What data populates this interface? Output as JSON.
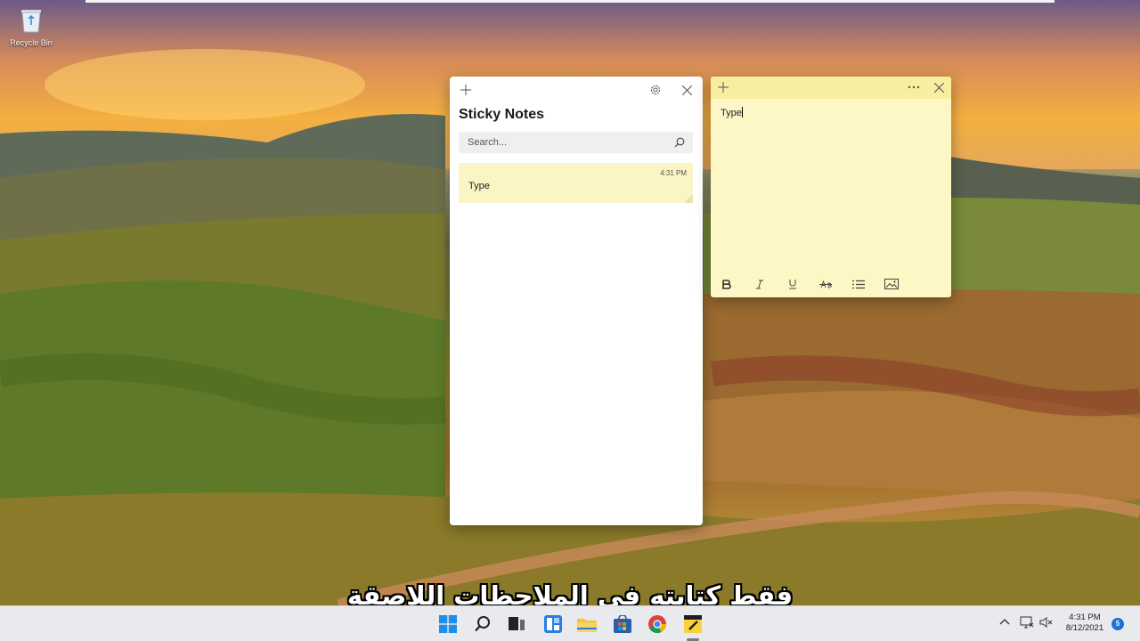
{
  "desktop": {
    "recycle_bin_label": "Recycle Bin"
  },
  "sticky_list": {
    "title": "Sticky Notes",
    "search_placeholder": "Search...",
    "notes": [
      {
        "time": "4:31 PM",
        "text": "Type"
      }
    ]
  },
  "sticky_note": {
    "text": "Type",
    "color": "#fdf7c6",
    "header_color": "#f8ee9f"
  },
  "taskbar": {
    "clock_time": "4:31 PM",
    "clock_date": "8/12/2021",
    "notification_count": "5",
    "pinned": [
      "windows-start-icon",
      "search-icon",
      "task-view-icon",
      "widgets-icon",
      "file-explorer-icon",
      "store-icon",
      "chrome-icon",
      "sticky-notes-icon"
    ]
  },
  "subtitle": "فقط كتابته في الملاحظات اللاصقة"
}
